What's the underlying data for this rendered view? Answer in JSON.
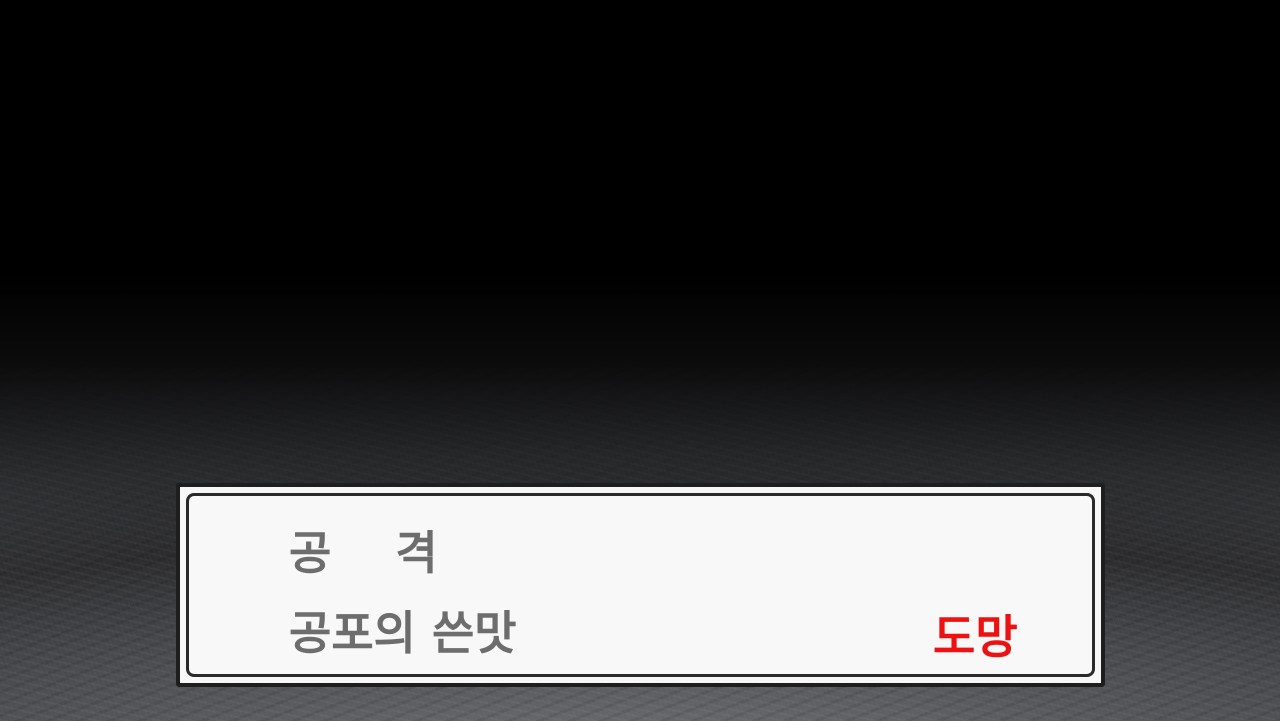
{
  "battle_menu": {
    "options": [
      {
        "label": "공    격",
        "color": "#6d6d6d"
      },
      {
        "label": "공포의 쓴맛",
        "color": "#6d6d6d"
      },
      {
        "label": "도망",
        "color": "#ee1111"
      }
    ]
  },
  "colors": {
    "window_fill": "#f7f7f7",
    "window_border": "#1e1e1e",
    "option_text": "#6d6d6d",
    "escape_text": "#ee1111"
  }
}
